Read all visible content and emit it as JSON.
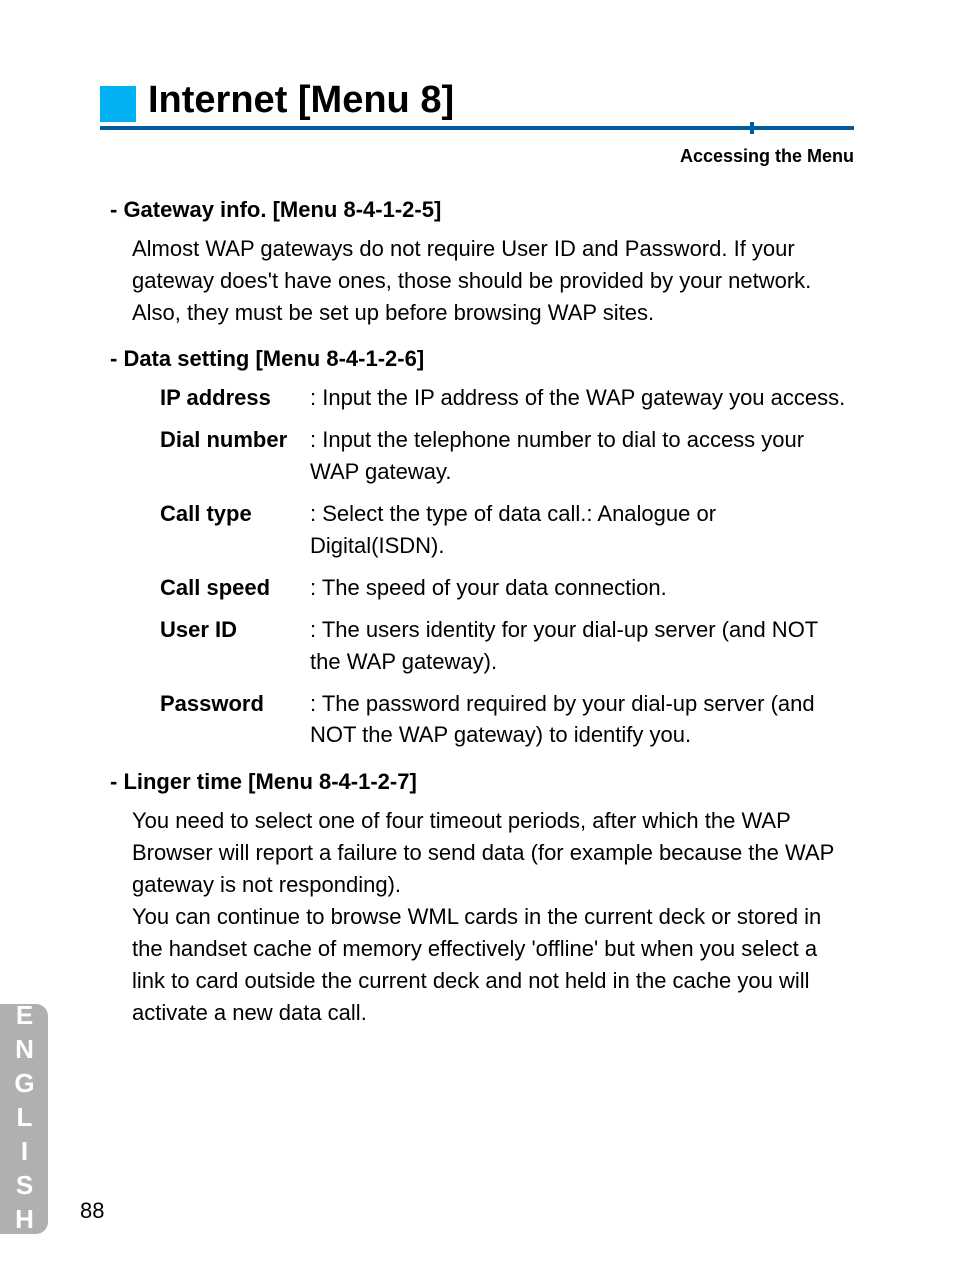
{
  "title": "Internet [Menu 8]",
  "subhead": "Accessing the Menu",
  "sections": {
    "gateway": {
      "heading": "- Gateway info. [Menu 8-4-1-2-5]",
      "body": "Almost WAP gateways do not require User ID and Password. If your gateway does't have ones, those should be provided by your network. Also, they must be set up before browsing WAP sites."
    },
    "data_setting": {
      "heading": "- Data setting [Menu 8-4-1-2-6]",
      "items": [
        {
          "term": "IP address",
          "desc": ": Input the IP address of the WAP gateway you access."
        },
        {
          "term": "Dial number",
          "desc": ": Input the telephone number to dial to access your WAP gateway."
        },
        {
          "term": "Call type",
          "desc": ": Select the type of data call.: Analogue or Digital(ISDN)."
        },
        {
          "term": "Call speed",
          "desc": ": The speed of your data connection."
        },
        {
          "term": "User ID",
          "desc": ": The users identity for your dial-up server (and NOT the WAP gateway)."
        },
        {
          "term": "Password",
          "desc": ": The password required by your dial-up server (and NOT the WAP gateway) to identify you."
        }
      ]
    },
    "linger": {
      "heading": "- Linger time [Menu 8-4-1-2-7]",
      "body": "You need to select one of four timeout periods, after which the WAP Browser will report a failure to send data (for example because the WAP gateway is not responding).\nYou can continue to browse WML cards in the current deck or stored in the handset cache of memory effectively 'offline' but when you select a link to card outside the current deck and not held in the cache you will activate a new data call."
    }
  },
  "side_label": "ENGLISH",
  "page_number": "88"
}
